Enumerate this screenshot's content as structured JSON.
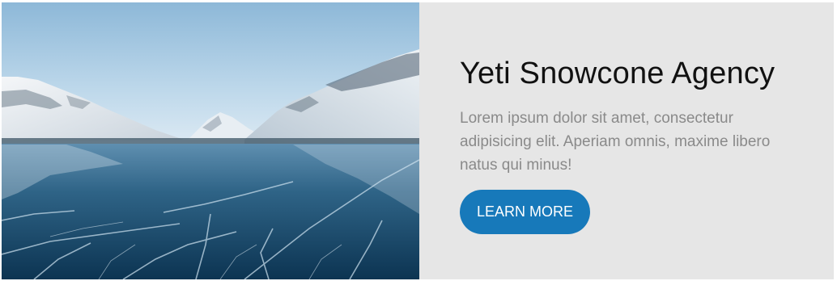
{
  "card": {
    "image_alt": "Frozen lake with snowy mountains",
    "title": "Yeti Snowcone Agency",
    "description": "Lorem ipsum dolor sit amet, consectetur adipisicing elit. Aperiam omnis, maxime libero natus qui minus!",
    "button_label": "LEARN MORE"
  },
  "colors": {
    "panel_background": "#e6e6e6",
    "button_background": "#1779ba",
    "title_text": "#111111",
    "body_text": "#8a8a8a"
  }
}
